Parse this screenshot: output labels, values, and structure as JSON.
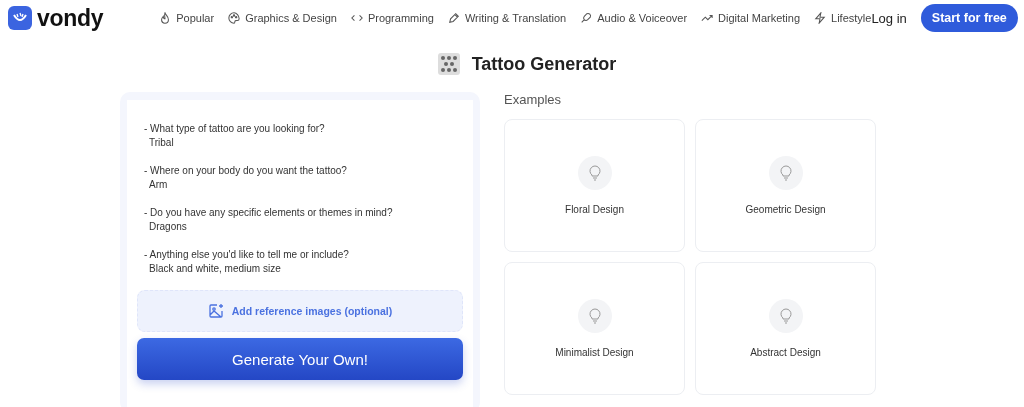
{
  "header": {
    "brand": "vondy",
    "nav": [
      "Popular",
      "Graphics & Design",
      "Programming",
      "Writing & Translation",
      "Audio & Voiceover",
      "Digital Marketing",
      "Lifestyle"
    ],
    "login": "Log in",
    "cta": "Start for free"
  },
  "title": "Tattoo Generator",
  "prompt": [
    {
      "question": "- What type of tattoo are you looking for?",
      "answer": "Tribal"
    },
    {
      "question": "- Where on your body do you want the tattoo?",
      "answer": "Arm"
    },
    {
      "question": "- Do you have any specific elements or themes in mind?",
      "answer": "Dragons"
    },
    {
      "question": "- Anything else you'd like to tell me or include?",
      "answer": "Black and white, medium size"
    }
  ],
  "upload": "Add reference images (optional)",
  "generate": "Generate Your Own!",
  "examples": {
    "heading": "Examples",
    "items": [
      "Floral Design",
      "Geometric Design",
      "Minimalist Design",
      "Abstract Design"
    ]
  }
}
